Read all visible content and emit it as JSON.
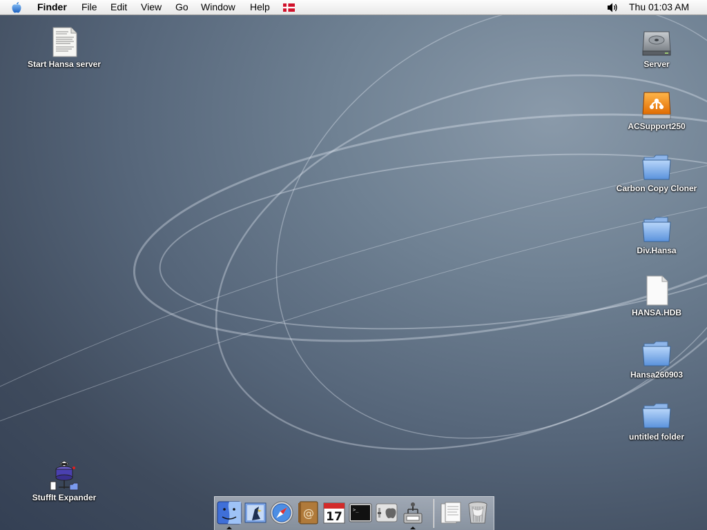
{
  "menubar": {
    "apple_icon": "apple-icon",
    "app_name": "Finder",
    "menus": [
      "File",
      "Edit",
      "View",
      "Go",
      "Window",
      "Help"
    ],
    "input_source_icon": "danish-flag-icon",
    "volume_icon": "speaker-volume-icon",
    "clock": "Thu 01:03 AM"
  },
  "desktop": {
    "icons_left": [
      {
        "label": "Start Hansa server",
        "icon": "text-document-icon"
      },
      {
        "label": "StuffIt Expander",
        "icon": "stuffit-expander-icon"
      }
    ],
    "icons_right": [
      {
        "label": "Server",
        "icon": "hard-drive-icon"
      },
      {
        "label": "ACSupport250",
        "icon": "firewire-drive-icon"
      },
      {
        "label": "Carbon Copy Cloner",
        "icon": "folder-icon"
      },
      {
        "label": "Div.Hansa",
        "icon": "folder-icon"
      },
      {
        "label": "HANSA.HDB",
        "icon": "blank-document-icon"
      },
      {
        "label": "Hansa260903",
        "icon": "folder-icon"
      },
      {
        "label": "untitled folder",
        "icon": "folder-icon"
      }
    ]
  },
  "dock": {
    "items": [
      {
        "name": "Finder",
        "icon": "finder-icon",
        "running": true
      },
      {
        "name": "Mail",
        "icon": "mail-icon",
        "running": false
      },
      {
        "name": "Safari",
        "icon": "safari-compass-icon",
        "running": false
      },
      {
        "name": "Address Book",
        "icon": "address-book-icon",
        "running": false
      },
      {
        "name": "iCal",
        "icon": "calendar-icon",
        "running": false,
        "date": "17"
      },
      {
        "name": "Terminal",
        "icon": "terminal-icon",
        "running": false
      },
      {
        "name": "System Preferences",
        "icon": "system-preferences-icon",
        "running": false
      },
      {
        "name": "Installer",
        "icon": "installer-icon",
        "running": true
      },
      {
        "name": "Documents",
        "icon": "documents-stack-icon",
        "running": false
      },
      {
        "name": "Trash",
        "icon": "trash-icon",
        "running": false
      }
    ]
  }
}
